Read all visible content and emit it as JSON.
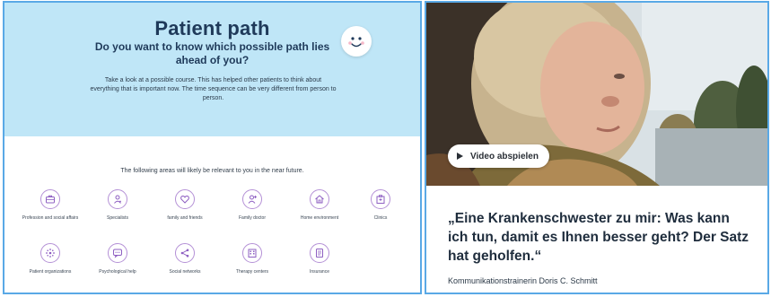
{
  "patient_path": {
    "title": "Patient path",
    "subtitle": "Do you want to know which possible path lies ahead of you?",
    "description": "Take a look at a possible course. This has helped other patients to think about everything that is important now. The time sequence can be very different from person to person.",
    "areas_intro": "The following areas will likely be relevant to you in the near future.",
    "accent_color": "#b490d6",
    "hero_color": "#bfe6f7",
    "areas": [
      {
        "label": "Profession and social affairs",
        "icon": "briefcase-icon"
      },
      {
        "label": "Specialists",
        "icon": "specialist-icon"
      },
      {
        "label": "family and friends",
        "icon": "heart-icon"
      },
      {
        "label": "Family doctor",
        "icon": "doctor-icon"
      },
      {
        "label": "Home environment",
        "icon": "home-icon"
      },
      {
        "label": "Clinics",
        "icon": "clinic-icon"
      },
      {
        "label": "Patient organizations",
        "icon": "organization-icon"
      },
      {
        "label": "Psychological help",
        "icon": "chat-icon"
      },
      {
        "label": "Social networks",
        "icon": "share-icon"
      },
      {
        "label": "Therapy centers",
        "icon": "building-icon"
      },
      {
        "label": "Insurance",
        "icon": "document-icon"
      }
    ]
  },
  "testimonial": {
    "play_label": "Video abspielen",
    "quote": "„Eine Krankenschwester zu mir: Was kann ich tun, damit es Ihnen besser geht? Der Satz hat geholfen.“",
    "author": "Kommunikationstrainerin Doris C. Schmitt"
  }
}
